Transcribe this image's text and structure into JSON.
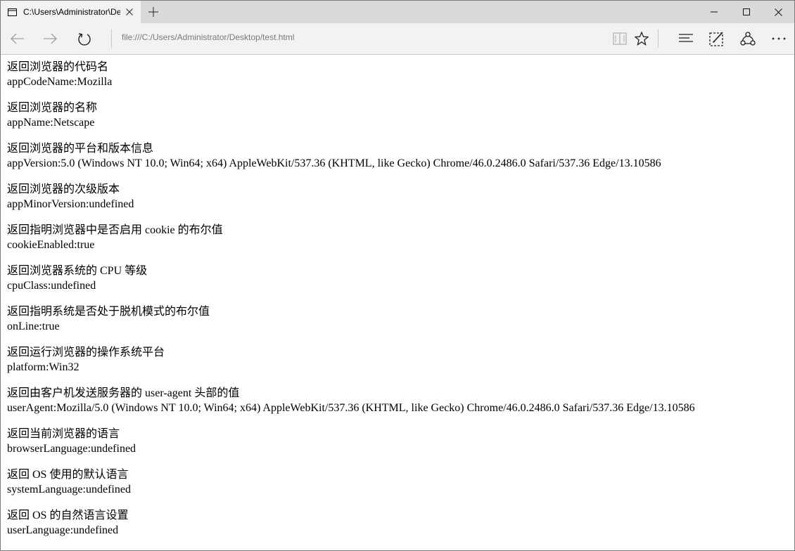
{
  "tab": {
    "title": "C:\\Users\\Administrator\\Desktop\\test.html",
    "icon": "page-icon"
  },
  "window_controls": [
    "minimize-icon",
    "maximize-icon",
    "close-icon"
  ],
  "address_bar": {
    "url": "file:///C:/Users/Administrator/Desktop/test.html"
  },
  "toolbar_icons": [
    "back-icon",
    "forward-icon",
    "refresh-icon",
    "reading-view-icon",
    "favorite-star-icon",
    "hub-icon",
    "web-note-icon",
    "share-icon",
    "more-icon"
  ],
  "entries": [
    {
      "label": "返回浏览器的代码名",
      "value": "appCodeName:Mozilla"
    },
    {
      "label": "返回浏览器的名称",
      "value": "appName:Netscape"
    },
    {
      "label": "返回浏览器的平台和版本信息",
      "value": "appVersion:5.0 (Windows NT 10.0; Win64; x64) AppleWebKit/537.36 (KHTML, like Gecko) Chrome/46.0.2486.0 Safari/537.36 Edge/13.10586"
    },
    {
      "label": "返回浏览器的次级版本",
      "value": "appMinorVersion:undefined"
    },
    {
      "label": "返回指明浏览器中是否启用 cookie 的布尔值",
      "value": "cookieEnabled:true"
    },
    {
      "label": "返回浏览器系统的 CPU 等级",
      "value": "cpuClass:undefined"
    },
    {
      "label": "返回指明系统是否处于脱机模式的布尔值",
      "value": "onLine:true"
    },
    {
      "label": "返回运行浏览器的操作系统平台",
      "value": "platform:Win32"
    },
    {
      "label": "返回由客户机发送服务器的 user-agent 头部的值",
      "value": "userAgent:Mozilla/5.0 (Windows NT 10.0; Win64; x64) AppleWebKit/537.36 (KHTML, like Gecko) Chrome/46.0.2486.0 Safari/537.36 Edge/13.10586"
    },
    {
      "label": "返回当前浏览器的语言",
      "value": "browserLanguage:undefined"
    },
    {
      "label": "返回 OS 使用的默认语言",
      "value": "systemLanguage:undefined"
    },
    {
      "label": "返回 OS 的自然语言设置",
      "value": "userLanguage:undefined"
    }
  ]
}
